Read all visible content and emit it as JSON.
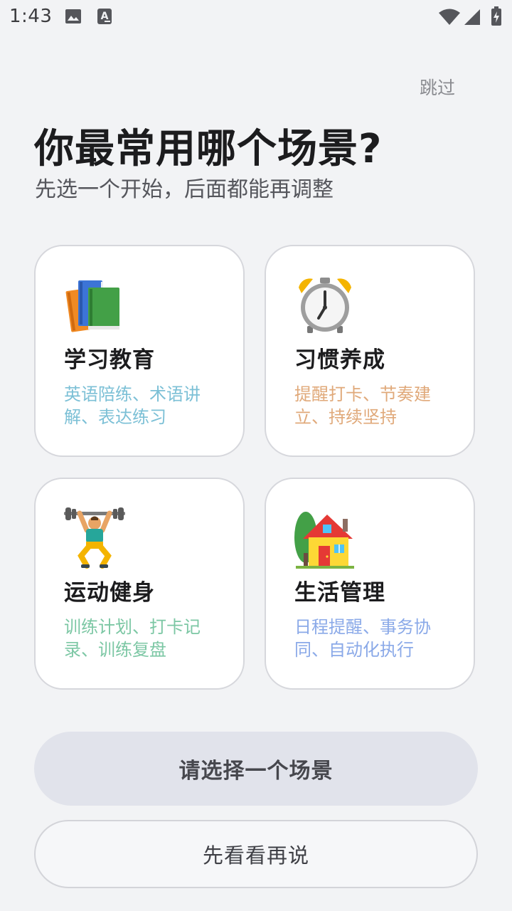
{
  "status_bar": {
    "time": "1:43",
    "icons": [
      "image-icon",
      "text-recognition-icon",
      "wifi-icon",
      "cell-signal-icon",
      "battery-charging-icon"
    ]
  },
  "skip_label": "跳过",
  "title": "你最常用哪个场景?",
  "subtitle": "先选一个开始，后面都能再调整",
  "scenes": [
    {
      "icon": "books-icon",
      "title": "学习教育",
      "description": "英语陪练、术语讲解、表达练习",
      "color": "#7cc0d6"
    },
    {
      "icon": "alarm-clock-icon",
      "title": "习惯养成",
      "description": "提醒打卡、节奏建立、持续坚持",
      "color": "#e0a97a"
    },
    {
      "icon": "weightlifter-icon",
      "title": "运动健身",
      "description": "训练计划、打卡记录、训练复盘",
      "color": "#7cc7a4"
    },
    {
      "icon": "house-icon",
      "title": "生活管理",
      "description": "日程提醒、事务协同、自动化执行",
      "color": "#8aa9e8"
    }
  ],
  "primary_button": "请选择一个场景",
  "secondary_button": "先看看再说"
}
